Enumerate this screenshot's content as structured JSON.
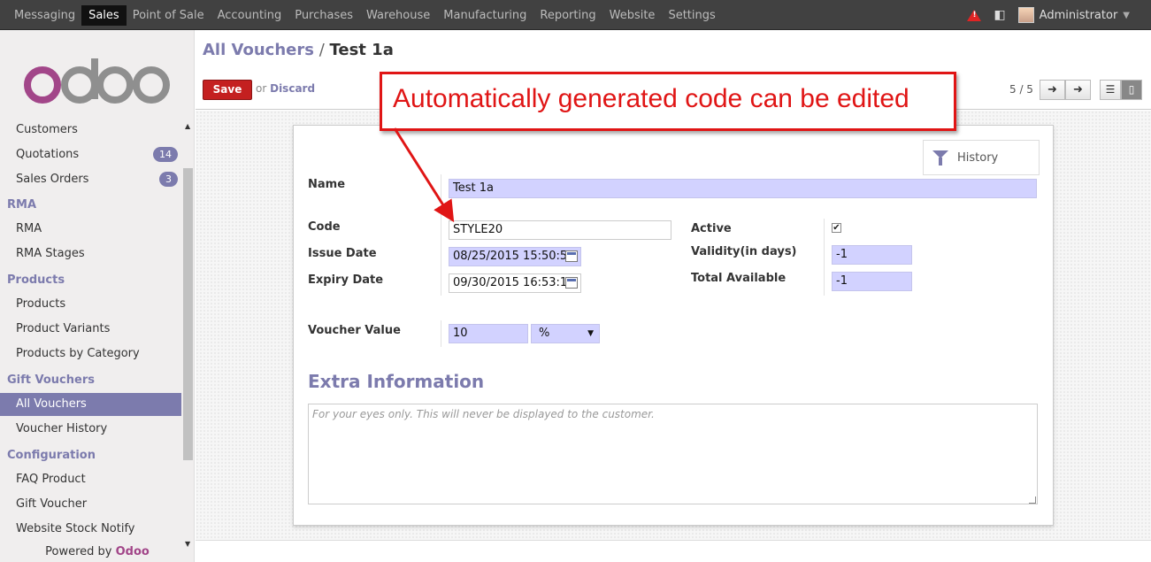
{
  "topbar": {
    "menu": [
      "Messaging",
      "Sales",
      "Point of Sale",
      "Accounting",
      "Purchases",
      "Warehouse",
      "Manufacturing",
      "Reporting",
      "Website",
      "Settings"
    ],
    "active": "Sales",
    "user": "Administrator",
    "icons": [
      "warning-icon",
      "chat-icon",
      "avatar"
    ]
  },
  "sidebar": {
    "logo_text": "odoo",
    "items": [
      {
        "label": "Customers",
        "type": "item"
      },
      {
        "label": "Quotations",
        "type": "item",
        "badge": "14"
      },
      {
        "label": "Sales Orders",
        "type": "item",
        "badge": "3"
      },
      {
        "label": "RMA",
        "type": "head"
      },
      {
        "label": "RMA",
        "type": "item"
      },
      {
        "label": "RMA Stages",
        "type": "item"
      },
      {
        "label": "Products",
        "type": "head"
      },
      {
        "label": "Products",
        "type": "item"
      },
      {
        "label": "Product Variants",
        "type": "item"
      },
      {
        "label": "Products by Category",
        "type": "item"
      },
      {
        "label": "Gift Vouchers",
        "type": "head"
      },
      {
        "label": "All Vouchers",
        "type": "item",
        "active": true
      },
      {
        "label": "Voucher History",
        "type": "item"
      },
      {
        "label": "Configuration",
        "type": "head"
      },
      {
        "label": "FAQ Product",
        "type": "item"
      },
      {
        "label": "Gift Voucher",
        "type": "item"
      },
      {
        "label": "Website Stock Notify",
        "type": "item"
      }
    ],
    "powered_prefix": "Powered by",
    "powered_brand": "Odoo"
  },
  "header": {
    "crumb_parent": "All Vouchers",
    "crumb_sep": "/",
    "crumb_current": "Test 1a",
    "save_label": "Save",
    "or_text": "or",
    "discard_label": "Discard",
    "pager": "5 / 5"
  },
  "form": {
    "history_label": "History",
    "name_label": "Name",
    "name_value": "Test 1a",
    "code_label": "Code",
    "code_value": "STYLE20",
    "issue_label": "Issue Date",
    "issue_value": "08/25/2015 15:50:54",
    "expiry_label": "Expiry Date",
    "expiry_value": "09/30/2015 16:53:16",
    "active_label": "Active",
    "active_checked": true,
    "validity_label": "Validity(in days)",
    "validity_value": "-1",
    "total_label": "Total Available",
    "total_value": "-1",
    "voucher_label": "Voucher Value",
    "voucher_value": "10",
    "voucher_unit": "%",
    "extra_title": "Extra Information",
    "notes_placeholder": "For your eyes only. This will never be displayed to the customer."
  },
  "annotation": {
    "text": "Automatically generated code can be edited",
    "color": "#e01515"
  },
  "colors": {
    "accent": "#7c7bad",
    "save": "#c42020",
    "required": "#d2d2ff"
  }
}
